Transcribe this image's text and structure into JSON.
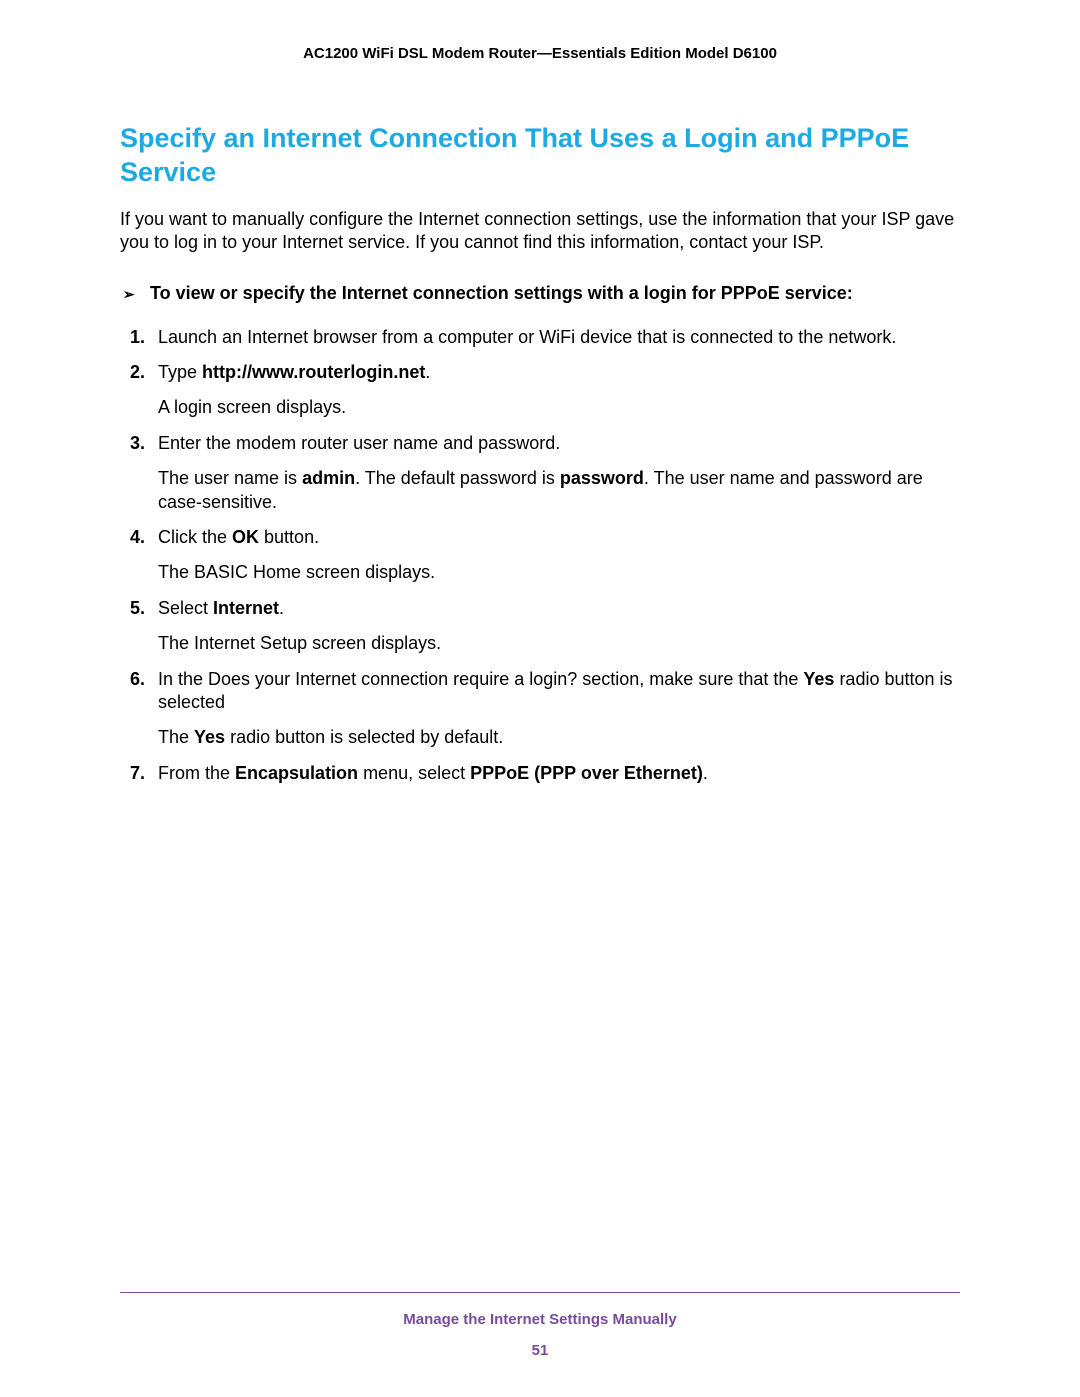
{
  "header": "AC1200 WiFi DSL Modem Router—Essentials Edition Model D6100",
  "section_title": "Specify an Internet Connection That Uses a Login and PPPoE Service",
  "intro": "If you want to manually configure the Internet connection settings, use the information that your ISP gave you to log in to your Internet service. If you cannot find this information, contact your ISP.",
  "procedure_intro": "To view or specify the Internet connection settings with a login for PPPoE service:",
  "arrow": "➢",
  "steps": {
    "s1": {
      "num": "1.",
      "text": "Launch an Internet browser from a computer or WiFi device that is connected to the network."
    },
    "s2": {
      "num": "2.",
      "pre": "Type ",
      "url": "http://www.routerlogin.net",
      "post": ".",
      "sub": "A login screen displays."
    },
    "s3": {
      "num": "3.",
      "text": "Enter the modem router user name and password.",
      "sub_pre": "The user name is ",
      "sub_b1": "admin",
      "sub_mid": ". The default password is ",
      "sub_b2": "password",
      "sub_post": ". The user name and password are case-sensitive."
    },
    "s4": {
      "num": "4.",
      "pre": "Click the ",
      "b": "OK",
      "post": " button.",
      "sub": "The BASIC Home screen displays."
    },
    "s5": {
      "num": "5.",
      "pre": "Select ",
      "b": "Internet",
      "post": ".",
      "sub": "The Internet Setup screen displays."
    },
    "s6": {
      "num": "6.",
      "pre": "In the Does your Internet connection require a login? section, make sure that the ",
      "b": "Yes",
      "post": " radio button is selected",
      "sub_pre": "The ",
      "sub_b": "Yes",
      "sub_post": " radio button is selected by default."
    },
    "s7": {
      "num": "7.",
      "pre": "From the ",
      "b1": "Encapsulation",
      "mid": " menu, select ",
      "b2": "PPPoE (PPP over Ethernet)",
      "post": "."
    }
  },
  "footer": {
    "text": "Manage the Internet Settings Manually",
    "page": "51"
  }
}
